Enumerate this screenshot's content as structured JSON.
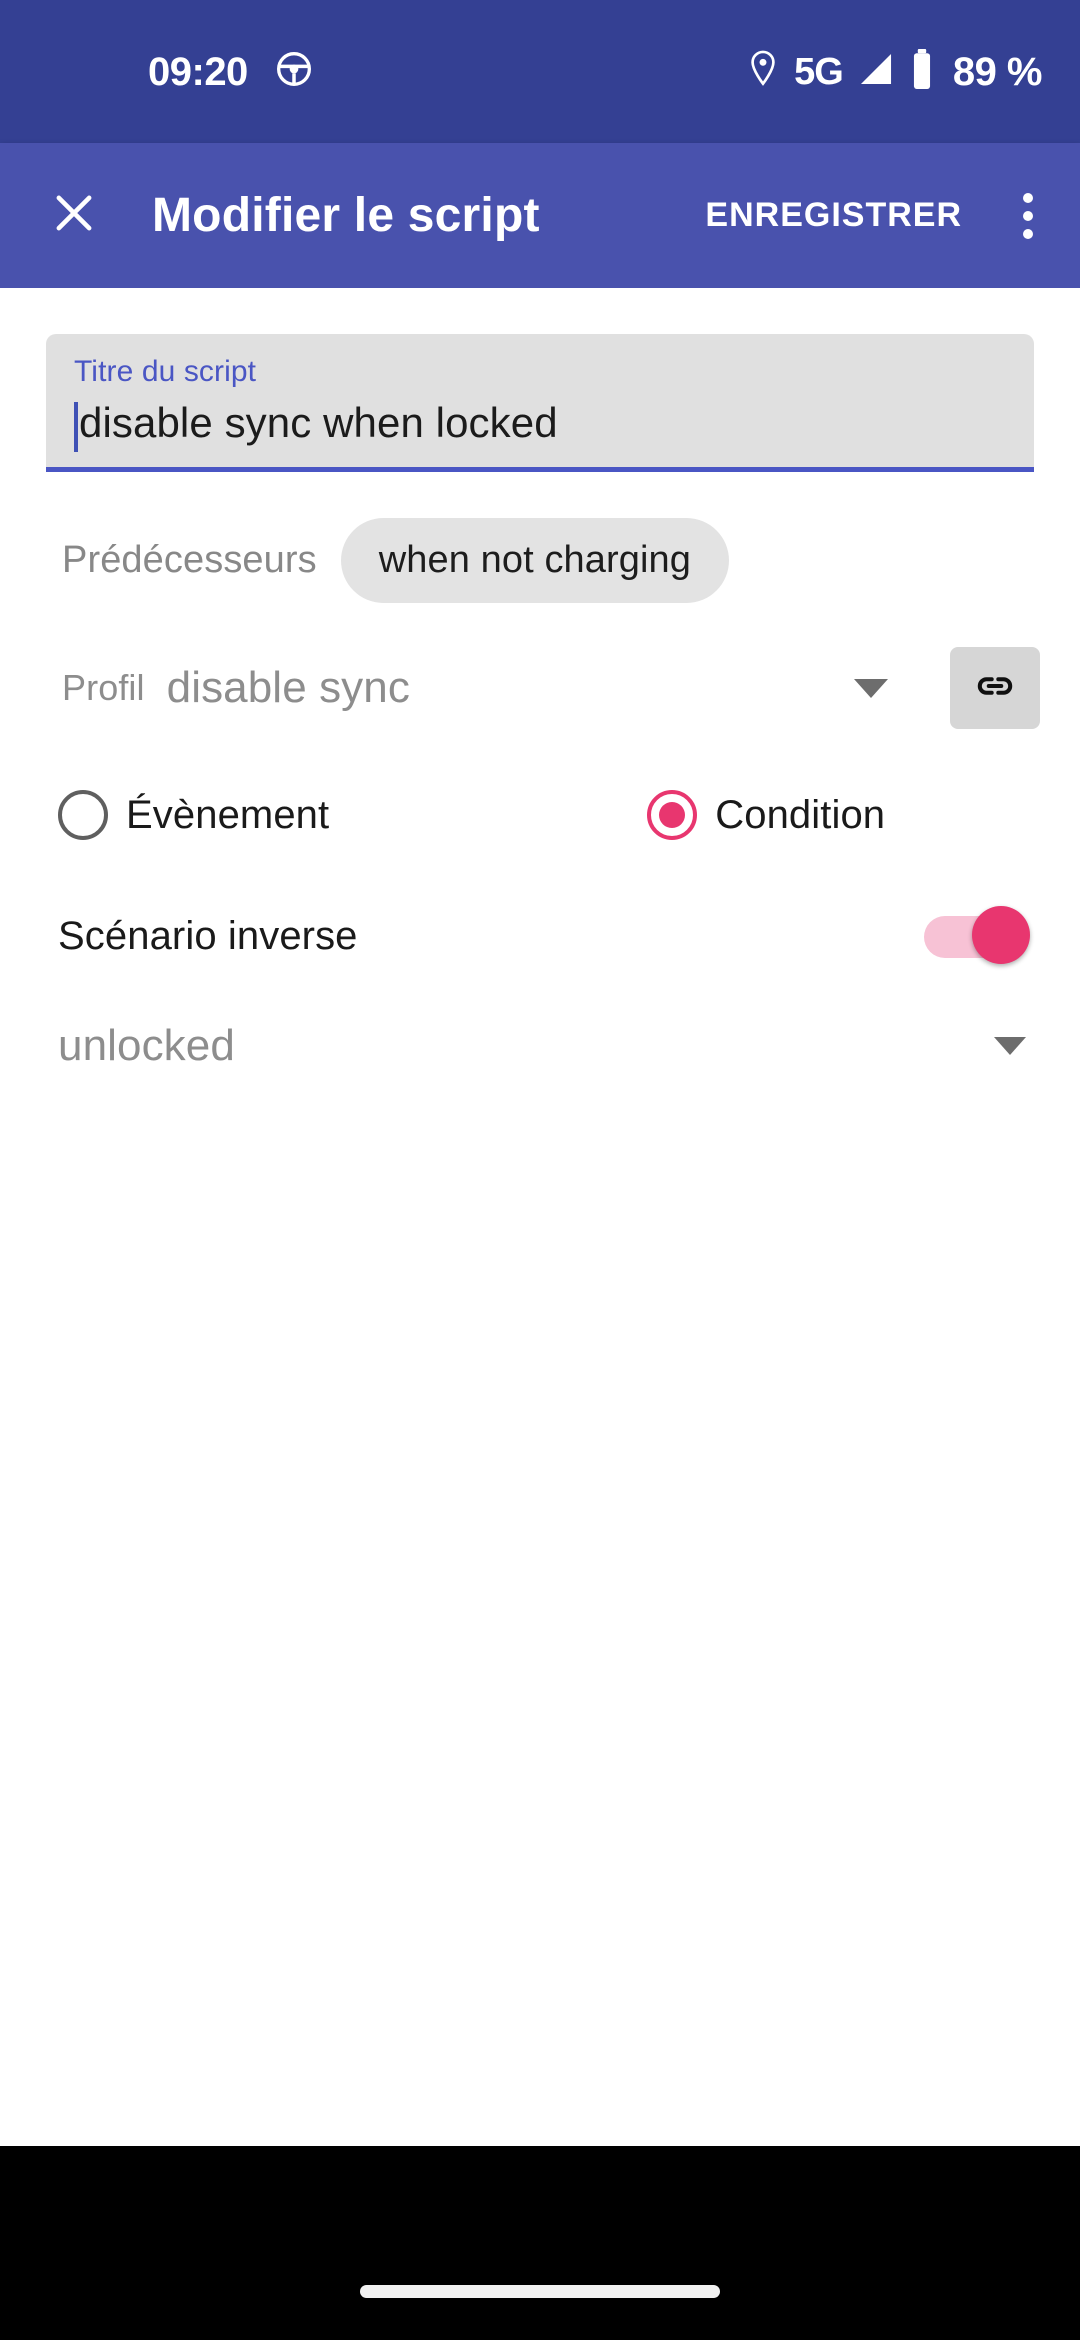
{
  "status_bar": {
    "time": "09:20",
    "driving_icon": "steering-wheel-icon",
    "location_icon": "location-pin-icon",
    "network_type": "5G",
    "signal_icon": "signal-triangle-icon",
    "battery_icon": "battery-icon",
    "battery_level": "89 %",
    "background_color": "#344093"
  },
  "app_bar": {
    "close_icon": "close-icon",
    "title": "Modifier le script",
    "save_label": "ENREGISTRER",
    "overflow_icon": "overflow-menu-icon",
    "background_color": "#4952ad"
  },
  "title_field": {
    "label": "Titre du script",
    "value": "disable sync when locked",
    "placeholder": "Titre du script",
    "label_color": "#4a56c4",
    "underline_color": "#4a56c4",
    "fill_color": "#e0e0e0"
  },
  "predecessors": {
    "label": "Prédécesseurs",
    "chips": [
      "when not charging"
    ]
  },
  "profile": {
    "label": "Profil",
    "value": "disable sync",
    "dropdown_icon": "chevron-down-icon",
    "link_button_icon": "link-icon"
  },
  "trigger_type": {
    "options": [
      {
        "label": "Évènement",
        "selected": false
      },
      {
        "label": "Condition",
        "selected": true
      }
    ],
    "selected_color": "#e8366f"
  },
  "inverse_scenario": {
    "label": "Scénario inverse",
    "enabled": true,
    "accent_color": "#e8366f"
  },
  "state_select": {
    "value": "unlocked",
    "dropdown_icon": "chevron-down-icon"
  },
  "navigation_bar": {
    "gesture_pill": "gesture-pill"
  }
}
